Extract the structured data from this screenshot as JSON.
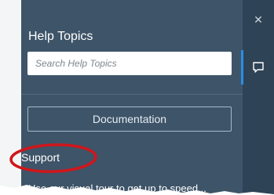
{
  "help": {
    "title": "Help Topics",
    "search_placeholder": "Search Help Topics",
    "documentation_label": "Documentation",
    "support_label": "Support",
    "cut_off_text": "Use our visual tour to get up to speed..."
  },
  "icons": {
    "close": "close-icon",
    "chat": "chat-icon"
  },
  "colors": {
    "panel": "#3e5468",
    "rail": "#2f4356",
    "accent": "#2a8ee5",
    "annotation": "#d0161b"
  }
}
